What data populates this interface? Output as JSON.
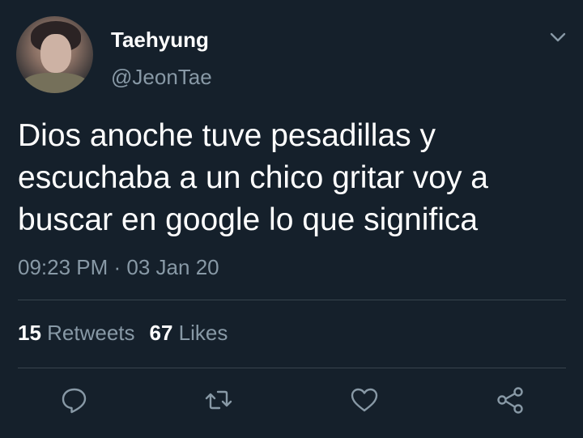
{
  "tweet": {
    "author": {
      "display_name": "Taehyung",
      "handle": "@JeonTae"
    },
    "text_lines": [
      "Dios anoche tuve pesadillas y",
      "escuchaba a un chico gritar voy a",
      "buscar en google lo que significa"
    ],
    "time": "09:23 PM",
    "separator": " · ",
    "date": "03 Jan 20",
    "stats": {
      "retweets_count": "15",
      "retweets_label": " Retweets",
      "likes_count": "67",
      "likes_label": " Likes"
    },
    "actions": [
      "reply-icon",
      "retweet-icon",
      "like-icon",
      "share-icon"
    ]
  },
  "colors": {
    "background": "#15202b",
    "primary_text": "#ffffff",
    "secondary_text": "#8899a6",
    "divider": "#38444d"
  }
}
